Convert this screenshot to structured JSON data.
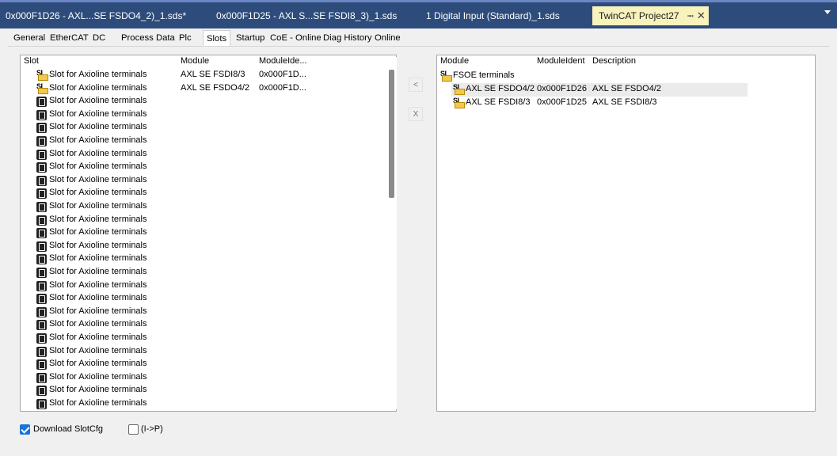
{
  "document_tabs": [
    {
      "label": "0x000F1D26 - AXL...SE FSDO4_2)_1.sds*",
      "active": false
    },
    {
      "label": "0x000F1D25 - AXL S...SE FSDI8_3)_1.sds",
      "active": false
    },
    {
      "label": "1 Digital Input (Standard)_1.sds",
      "active": false
    },
    {
      "label": "TwinCAT Project27",
      "active": true
    }
  ],
  "tab_controls": {
    "pin_icon": "pin-icon",
    "close_icon": "close-icon",
    "dropdown_icon": "chevron-down-icon"
  },
  "property_tabs": [
    "General",
    "EtherCAT",
    "DC",
    "Process Data",
    "Plc",
    "Slots",
    "Startup",
    "CoE - Online",
    "Diag History",
    "Online"
  ],
  "selected_property_tab": "Slots",
  "slots": {
    "columns": [
      "Slot",
      "Module",
      "ModuleIde..."
    ],
    "rows": [
      {
        "slot": "Slot for Axioline terminals",
        "module": "AXL SE FSDI8/3",
        "ident": "0x000F1D...",
        "icon": "safety-module-icon"
      },
      {
        "slot": "Slot for Axioline terminals",
        "module": "AXL SE FSDO4/2",
        "ident": "0x000F1D...",
        "icon": "safety-module-icon"
      },
      {
        "slot": "Slot for Axioline terminals",
        "module": "",
        "ident": "",
        "icon": "empty-slot-icon"
      },
      {
        "slot": "Slot for Axioline terminals",
        "module": "",
        "ident": "",
        "icon": "empty-slot-icon"
      },
      {
        "slot": "Slot for Axioline terminals",
        "module": "",
        "ident": "",
        "icon": "empty-slot-icon"
      },
      {
        "slot": "Slot for Axioline terminals",
        "module": "",
        "ident": "",
        "icon": "empty-slot-icon"
      },
      {
        "slot": "Slot for Axioline terminals",
        "module": "",
        "ident": "",
        "icon": "empty-slot-icon"
      },
      {
        "slot": "Slot for Axioline terminals",
        "module": "",
        "ident": "",
        "icon": "empty-slot-icon"
      },
      {
        "slot": "Slot for Axioline terminals",
        "module": "",
        "ident": "",
        "icon": "empty-slot-icon"
      },
      {
        "slot": "Slot for Axioline terminals",
        "module": "",
        "ident": "",
        "icon": "empty-slot-icon"
      },
      {
        "slot": "Slot for Axioline terminals",
        "module": "",
        "ident": "",
        "icon": "empty-slot-icon"
      },
      {
        "slot": "Slot for Axioline terminals",
        "module": "",
        "ident": "",
        "icon": "empty-slot-icon"
      },
      {
        "slot": "Slot for Axioline terminals",
        "module": "",
        "ident": "",
        "icon": "empty-slot-icon"
      },
      {
        "slot": "Slot for Axioline terminals",
        "module": "",
        "ident": "",
        "icon": "empty-slot-icon"
      },
      {
        "slot": "Slot for Axioline terminals",
        "module": "",
        "ident": "",
        "icon": "empty-slot-icon"
      },
      {
        "slot": "Slot for Axioline terminals",
        "module": "",
        "ident": "",
        "icon": "empty-slot-icon"
      },
      {
        "slot": "Slot for Axioline terminals",
        "module": "",
        "ident": "",
        "icon": "empty-slot-icon"
      },
      {
        "slot": "Slot for Axioline terminals",
        "module": "",
        "ident": "",
        "icon": "empty-slot-icon"
      },
      {
        "slot": "Slot for Axioline terminals",
        "module": "",
        "ident": "",
        "icon": "empty-slot-icon"
      },
      {
        "slot": "Slot for Axioline terminals",
        "module": "",
        "ident": "",
        "icon": "empty-slot-icon"
      },
      {
        "slot": "Slot for Axioline terminals",
        "module": "",
        "ident": "",
        "icon": "empty-slot-icon"
      },
      {
        "slot": "Slot for Axioline terminals",
        "module": "",
        "ident": "",
        "icon": "empty-slot-icon"
      },
      {
        "slot": "Slot for Axioline terminals",
        "module": "",
        "ident": "",
        "icon": "empty-slot-icon"
      },
      {
        "slot": "Slot for Axioline terminals",
        "module": "",
        "ident": "",
        "icon": "empty-slot-icon"
      },
      {
        "slot": "Slot for Axioline terminals",
        "module": "",
        "ident": "",
        "icon": "empty-slot-icon"
      },
      {
        "slot": "Slot for Axioline terminals",
        "module": "",
        "ident": "",
        "icon": "empty-slot-icon"
      }
    ]
  },
  "transfer_buttons": {
    "move_left": "<",
    "remove": "X"
  },
  "modules": {
    "columns": [
      "Module",
      "ModuleIdent",
      "Description"
    ],
    "group": {
      "label": "FSOE terminals",
      "icon": "safety-module-icon"
    },
    "rows": [
      {
        "module": "AXL SE FSDO4/2",
        "ident": "0x000F1D26",
        "description": "AXL SE FSDO4/2",
        "selected": true,
        "icon": "safety-module-icon"
      },
      {
        "module": "AXL SE FSDI8/3",
        "ident": "0x000F1D25",
        "description": "AXL SE FSDI8/3",
        "selected": false,
        "icon": "safety-module-icon"
      }
    ]
  },
  "options": {
    "download_slotcfg": {
      "label": "Download SlotCfg",
      "checked": true
    },
    "i_to_p": {
      "label": "(I->P)",
      "checked": false
    }
  },
  "colors": {
    "tab_bar": "#2d4c7c",
    "active_tab": "#f8f2bc",
    "checkbox_checked": "#1a73d8",
    "selected_row": "#ebebeb"
  }
}
